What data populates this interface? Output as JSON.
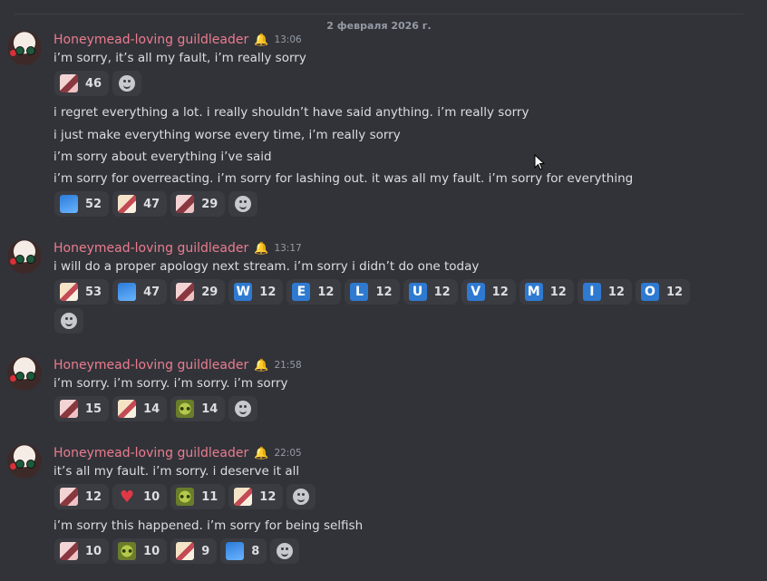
{
  "date_divider": "2 февраля 2026 г.",
  "messages": [
    {
      "username": "Honeymead-loving guildleader",
      "badge_icon": "crown-icon",
      "timestamp": "13:06",
      "lines": [
        "i’m sorry, it’s all my fault, i’m really sorry"
      ],
      "reactions": [
        {
          "emoji": "anime-girl-emoji",
          "count": "46"
        }
      ]
    },
    {
      "continuation": true,
      "lines": [
        "i regret everything a lot. i really shouldn’t have said anything. i’m really sorry",
        "i just make everything worse every time, i’m really sorry",
        "i’m sorry about everything i’ve said",
        "i’m sorry for overreacting. i’m sorry for lashing out. it was all my fault. i’m sorry for everything"
      ],
      "reactions": [
        {
          "emoji": "blue-hair-emoji",
          "count": "52"
        },
        {
          "emoji": "blonde-girl-emoji",
          "count": "47"
        },
        {
          "emoji": "anime-girl-emoji",
          "count": "29"
        }
      ]
    },
    {
      "username": "Honeymead-loving guildleader",
      "badge_icon": "crown-icon",
      "timestamp": "13:17",
      "lines": [
        "i will do a proper apology next stream. i’m sorry i didn’t do one today"
      ],
      "reactions": [
        {
          "emoji": "blonde-girl-emoji",
          "count": "53"
        },
        {
          "emoji": "blue-hair-emoji",
          "count": "47"
        },
        {
          "emoji": "anime-girl-emoji",
          "count": "29"
        },
        {
          "emoji": "letter-w",
          "letter": "W",
          "count": "12"
        },
        {
          "emoji": "letter-e",
          "letter": "E",
          "count": "12"
        },
        {
          "emoji": "letter-l",
          "letter": "L",
          "count": "12"
        },
        {
          "emoji": "letter-u",
          "letter": "U",
          "count": "12"
        },
        {
          "emoji": "letter-v",
          "letter": "V",
          "count": "12"
        },
        {
          "emoji": "letter-m",
          "letter": "M",
          "count": "12"
        },
        {
          "emoji": "letter-i",
          "letter": "I",
          "count": "12"
        },
        {
          "emoji": "letter-o",
          "letter": "O",
          "count": "12"
        }
      ]
    },
    {
      "username": "Honeymead-loving guildleader",
      "badge_icon": "crown-icon",
      "timestamp": "21:58",
      "lines": [
        "i’m sorry. i’m sorry. i’m sorry. i’m sorry"
      ],
      "reactions": [
        {
          "emoji": "anime-girl-emoji",
          "count": "15"
        },
        {
          "emoji": "blonde-girl-emoji",
          "count": "14"
        },
        {
          "emoji": "frog-emoji",
          "count": "14"
        }
      ]
    },
    {
      "username": "Honeymead-loving guildleader",
      "badge_icon": "crown-icon",
      "timestamp": "22:05",
      "lines": [
        "it’s all my fault. i’m sorry. i deserve it all"
      ],
      "reactions": [
        {
          "emoji": "anime-girl-emoji",
          "count": "12"
        },
        {
          "emoji": "heart-emoji",
          "count": "10"
        },
        {
          "emoji": "frog-emoji",
          "count": "11"
        },
        {
          "emoji": "blonde-girl-emoji",
          "count": "12"
        }
      ]
    },
    {
      "continuation": true,
      "lines": [
        "i’m sorry this happened. i’m sorry for being selfish"
      ],
      "reactions": [
        {
          "emoji": "anime-girl-emoji",
          "count": "10"
        },
        {
          "emoji": "frog-emoji",
          "count": "10"
        },
        {
          "emoji": "blonde-girl-emoji",
          "count": "9"
        },
        {
          "emoji": "blue-hair-emoji",
          "count": "8"
        }
      ]
    }
  ],
  "colors": {
    "background": "#323339",
    "username": "#eb7c8e",
    "reaction_bg": "#3b3c42",
    "letter_emoji": "#2f7ad1"
  }
}
